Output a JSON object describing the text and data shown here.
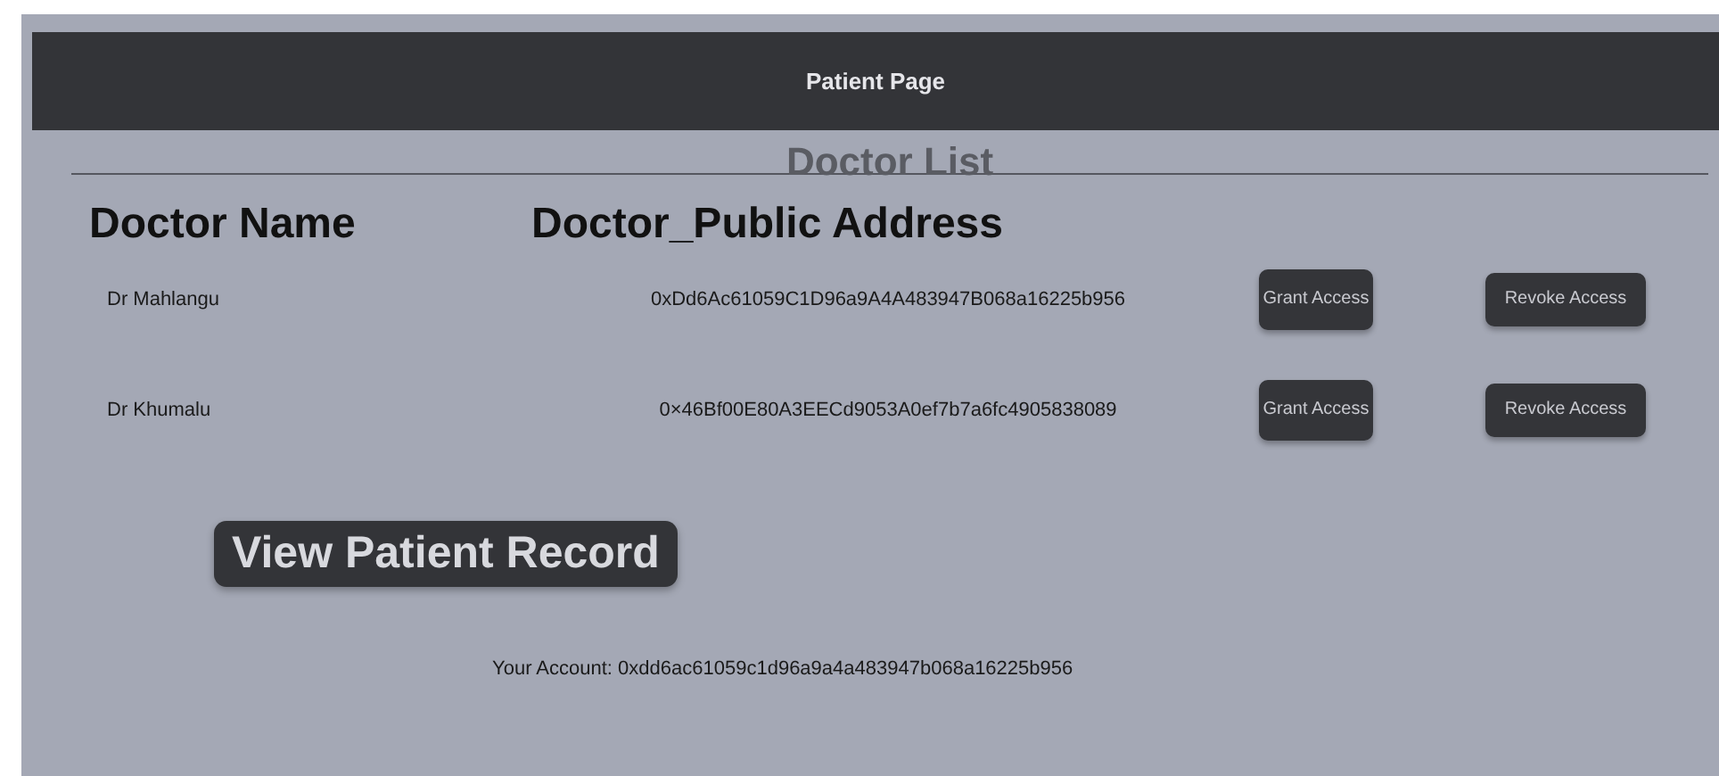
{
  "header": {
    "title": "Patient Page"
  },
  "section_title": "Doctor List",
  "columns": [
    "Doctor Name",
    "Doctor_Public Address"
  ],
  "doctors": [
    {
      "name": "Dr Mahlangu",
      "address": "0xDd6Ac61059C1D96a9A4A483947B068a16225b956",
      "actions": [
        "Grant Access",
        "Revoke Access"
      ]
    },
    {
      "name": "Dr Khumalu",
      "address": "0×46Bf00E80A3EECd9053A0ef7b7a6fc4905838089",
      "actions": [
        "Grant Access",
        "Revoke Access"
      ]
    }
  ],
  "view_button": "View Patient Record",
  "account": "Your Account: 0xdd6ac61059c1d96a9a4a483947b068a16225b956"
}
